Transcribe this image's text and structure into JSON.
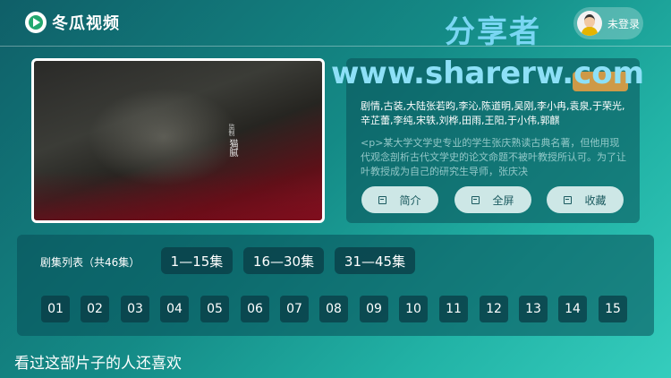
{
  "header": {
    "app_name": "冬瓜视频",
    "watermark": "分享者",
    "user_label": "未登录"
  },
  "player": {
    "caption_small": "监制",
    "caption": "猫腻"
  },
  "info": {
    "watermark_url": "www.sharerw.com",
    "genres": "剧情,古装,大陆张若昀,李沁,陈道明,吴刚,李小冉,袁泉,于荣光,辛芷蕾,李纯,宋轶,刘桦,田雨,王阳,于小伟,郭麒",
    "description": "<p>某大学文学史专业的学生张庆熟读古典名著，但他用现代观念剖析古代文学史的论文命题不被叶教授所认可。为了让叶教授成为自己的研究生导师，张庆决",
    "actions": [
      {
        "label": "简介",
        "icon": "doc-icon"
      },
      {
        "label": "全屏",
        "icon": "fullscreen-icon"
      },
      {
        "label": "收藏",
        "icon": "favorite-icon"
      }
    ]
  },
  "episodes": {
    "title": "剧集列表（共46集）",
    "ranges": [
      "1—15集",
      "16—30集",
      "31—45集"
    ],
    "list": [
      "01",
      "02",
      "03",
      "04",
      "05",
      "06",
      "07",
      "08",
      "09",
      "10",
      "11",
      "12",
      "13",
      "14",
      "15"
    ]
  },
  "recommend": {
    "title": "看过这部片子的人还喜欢"
  },
  "colors": {
    "bg_start": "#0f5f68",
    "bg_end": "#35cdbd",
    "watermark": "#79d6f3",
    "button_bg": "#cde7e6"
  }
}
